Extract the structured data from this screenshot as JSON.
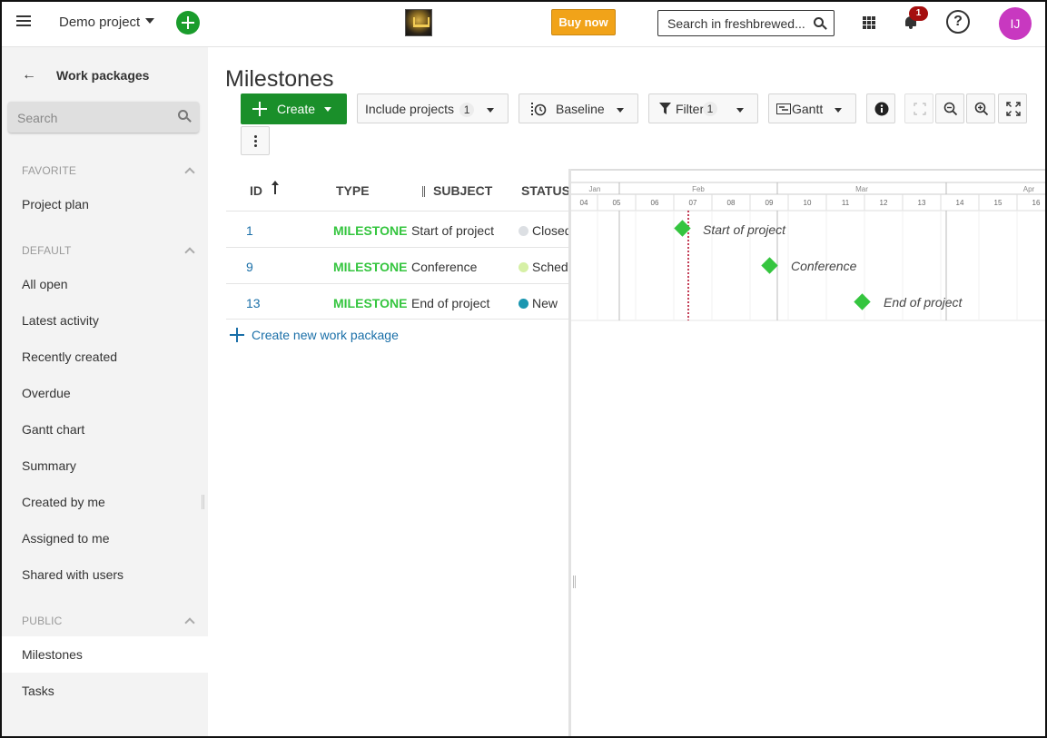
{
  "header": {
    "project": "Demo project",
    "buy_now": "Buy now",
    "search_placeholder": "Search in freshbrewed...",
    "notification_count": "1",
    "help": "?",
    "avatar_initials": "IJ"
  },
  "sidebar": {
    "title": "Work packages",
    "search_placeholder": "Search",
    "sections": {
      "favorite": "FAVORITE",
      "default": "DEFAULT",
      "public": "PUBLIC"
    },
    "favorite_items": [
      "Project plan"
    ],
    "default_items": [
      "All open",
      "Latest activity",
      "Recently created",
      "Overdue",
      "Gantt chart",
      "Summary",
      "Created by me",
      "Assigned to me",
      "Shared with users"
    ],
    "public_items": [
      "Milestones",
      "Tasks"
    ],
    "active_item": "Milestones"
  },
  "main": {
    "title": "Milestones",
    "toolbar": {
      "create": "Create",
      "include_projects": "Include projects",
      "include_projects_count": "1",
      "baseline": "Baseline",
      "filter": "Filter",
      "filter_count": "1",
      "view_mode": "Gantt"
    },
    "columns": [
      "ID",
      "TYPE",
      "SUBJECT",
      "STATUS"
    ],
    "rows": [
      {
        "id": "1",
        "type": "MILESTONE",
        "subject": "Start of project",
        "status": "Closed",
        "status_color": "#dcdfe3"
      },
      {
        "id": "9",
        "type": "MILESTONE",
        "subject": "Conference",
        "status": "Scheduled",
        "status_color": "#d6f0a6"
      },
      {
        "id": "13",
        "type": "MILESTONE",
        "subject": "End of project",
        "status": "New",
        "status_color": "#1a96b0"
      }
    ],
    "create_link": "Create new work package"
  },
  "gantt": {
    "months": [
      "Jan",
      "Feb",
      "Mar",
      "Apr"
    ],
    "weeks": [
      "04",
      "05",
      "06",
      "07",
      "08",
      "09",
      "10",
      "11",
      "12",
      "13",
      "14",
      "15",
      "16"
    ],
    "milestone_labels": [
      "Start of project",
      "Conference",
      "End of project"
    ],
    "milestone_color": "#35c53f",
    "today_line_color": "#b00020"
  }
}
